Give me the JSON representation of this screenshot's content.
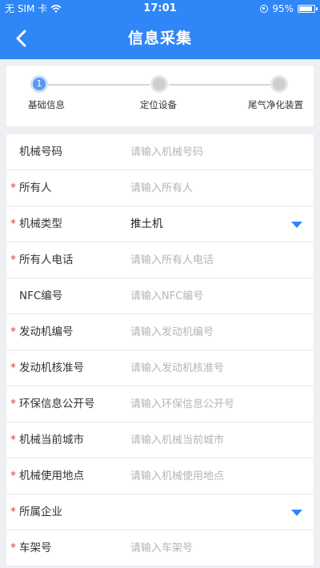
{
  "status_bar": {
    "carrier": "无 SIM 卡",
    "time": "17:01",
    "battery_percent": "95%",
    "battery_level": 0.95
  },
  "header": {
    "title": "信息采集"
  },
  "steps": [
    {
      "number": "1",
      "label": "基础信息",
      "state": "active"
    },
    {
      "number": "",
      "label": "定位设备",
      "state": "inactive"
    },
    {
      "number": "",
      "label": "尾气净化装置",
      "state": "inactive"
    }
  ],
  "form": {
    "fields": [
      {
        "label": "机械号码",
        "required": false,
        "type": "input",
        "placeholder": "请输入机械号码",
        "value": ""
      },
      {
        "label": "所有人",
        "required": true,
        "type": "input",
        "placeholder": "请输入所有人",
        "value": ""
      },
      {
        "label": "机械类型",
        "required": true,
        "type": "select",
        "value": "推土机"
      },
      {
        "label": "所有人电话",
        "required": true,
        "type": "input",
        "placeholder": "请输入所有人电话",
        "value": ""
      },
      {
        "label": "NFC编号",
        "required": false,
        "type": "input",
        "placeholder": "请输入NFC编号",
        "value": ""
      },
      {
        "label": "发动机编号",
        "required": true,
        "type": "input",
        "placeholder": "请输入发动机编号",
        "value": ""
      },
      {
        "label": "发动机核准号",
        "required": true,
        "type": "input",
        "placeholder": "请输入发动机核准号",
        "value": ""
      },
      {
        "label": "环保信息公开号",
        "required": true,
        "type": "input",
        "placeholder": "请输入环保信息公开号",
        "value": ""
      },
      {
        "label": "机械当前城市",
        "required": true,
        "type": "input",
        "placeholder": "请输入机械当前城市",
        "value": ""
      },
      {
        "label": "机械使用地点",
        "required": true,
        "type": "input",
        "placeholder": "请输入机械使用地点",
        "value": ""
      },
      {
        "label": "所属企业",
        "required": true,
        "type": "select",
        "value": ""
      },
      {
        "label": "车架号",
        "required": true,
        "type": "input",
        "placeholder": "请输入车架号",
        "value": ""
      }
    ],
    "required_mark": "*"
  },
  "colors": {
    "brand": "#2f86f6",
    "required": "#e23c3c",
    "active_step": "#5a98f0"
  },
  "icons": {
    "back": "chevron-left-icon",
    "dropdown": "caret-down-icon"
  }
}
